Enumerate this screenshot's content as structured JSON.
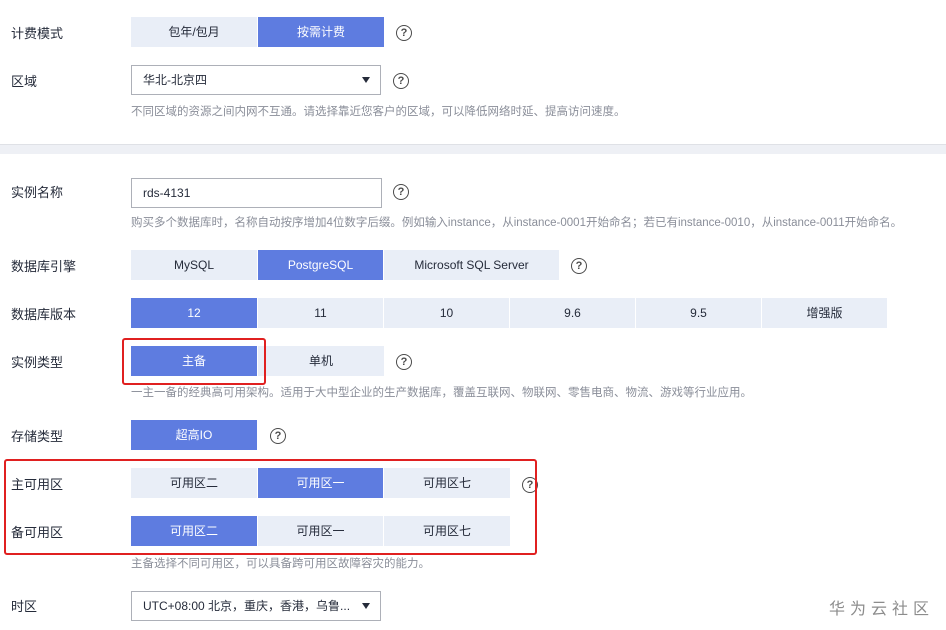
{
  "billing": {
    "label": "计费模式",
    "options": [
      "包年/包月",
      "按需计费"
    ],
    "selected": 1
  },
  "region": {
    "label": "区域",
    "value": "华北-北京四",
    "hint": "不同区域的资源之间内网不互通。请选择靠近您客户的区域，可以降低网络时延、提高访问速度。"
  },
  "instance_name": {
    "label": "实例名称",
    "value": "rds-4131",
    "hint": "购买多个数据库时，名称自动按序增加4位数字后缀。例如输入instance，从instance-0001开始命名；若已有instance-0010，从instance-0011开始命名。"
  },
  "engine": {
    "label": "数据库引擎",
    "options": [
      "MySQL",
      "PostgreSQL",
      "Microsoft SQL Server"
    ],
    "selected": 1
  },
  "version": {
    "label": "数据库版本",
    "options": [
      "12",
      "11",
      "10",
      "9.6",
      "9.5",
      "增强版"
    ],
    "selected": 0
  },
  "instance_type": {
    "label": "实例类型",
    "options": [
      "主备",
      "单机"
    ],
    "selected": 0,
    "hint": "一主一备的经典高可用架构。适用于大中型企业的生产数据库，覆盖互联网、物联网、零售电商、物流、游戏等行业应用。"
  },
  "storage": {
    "label": "存储类型",
    "options": [
      "超高IO"
    ],
    "selected": 0
  },
  "primary_az": {
    "label": "主可用区",
    "options": [
      "可用区二",
      "可用区一",
      "可用区七"
    ],
    "selected": 1
  },
  "standby_az": {
    "label": "备可用区",
    "options": [
      "可用区二",
      "可用区一",
      "可用区七"
    ],
    "selected": 0,
    "hint": "主备选择不同可用区，可以具备跨可用区故障容灾的能力。"
  },
  "timezone": {
    "label": "时区",
    "value": "UTC+08:00 北京，重庆，香港，乌鲁..."
  },
  "help_glyph": "?",
  "watermark": "华为云社区",
  "colors": {
    "accent": "#5e7ce0",
    "option_bg": "#e9eef7",
    "highlight_box": "#e02020"
  }
}
